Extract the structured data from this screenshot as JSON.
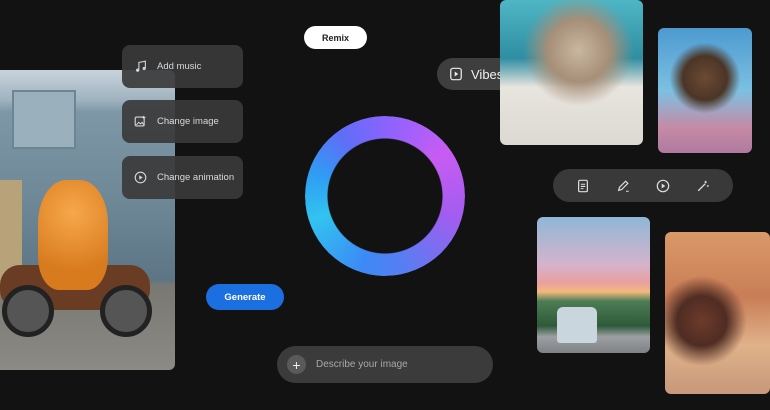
{
  "remix": {
    "label": "Remix"
  },
  "vibes": {
    "label": "Vibes",
    "icon": "play-square-icon"
  },
  "menu": [
    {
      "label": "Add music",
      "icon": "music-note-icon"
    },
    {
      "label": "Change image",
      "icon": "image-edit-icon"
    },
    {
      "label": "Change animation",
      "icon": "play-circle-icon"
    }
  ],
  "generate": {
    "label": "Generate"
  },
  "prompt": {
    "placeholder": "Describe your image",
    "icon": "plus-icon"
  },
  "toolbar": {
    "icons": [
      "document-icon",
      "pencil-icon",
      "play-circle-icon",
      "magic-wand-icon"
    ]
  },
  "colors": {
    "background": "#121212",
    "accent": "#1c6fe0",
    "ring_start": "#8a63ff",
    "ring_end": "#32c3f0"
  }
}
